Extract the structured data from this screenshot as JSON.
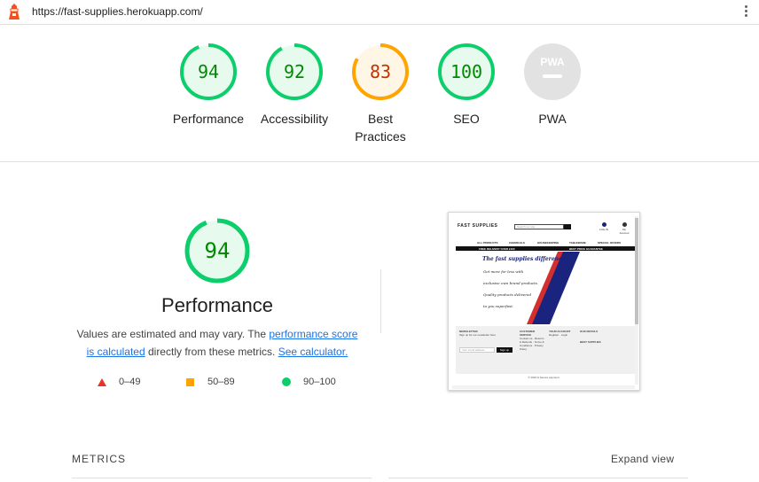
{
  "browser": {
    "url": "https://fast-supplies.herokuapp.com/"
  },
  "scores": [
    {
      "label": "Performance",
      "value": "94",
      "score": 0.94,
      "status": "pass"
    },
    {
      "label": "Accessibility",
      "value": "92",
      "score": 0.92,
      "status": "pass"
    },
    {
      "label": "Best Practices",
      "value": "83",
      "score": 0.83,
      "status": "average"
    },
    {
      "label": "SEO",
      "value": "100",
      "score": 1.0,
      "status": "pass"
    },
    {
      "label": "PWA",
      "value": "PWA",
      "score": null,
      "status": "na"
    }
  ],
  "colors": {
    "pass": "#0cce6b",
    "pass_text": "#008800",
    "pass_bg": "#e6fbee",
    "average": "#ffa400",
    "average_text": "#c33300",
    "average_bg": "#fff6e6",
    "fail": "#eb3324",
    "na": "#e2e2e2",
    "na_text": "#b9b9b9",
    "link": "#1a73e8"
  },
  "performance": {
    "score": "94",
    "title": "Performance",
    "desc_1": "Values are estimated and may vary. The ",
    "link_score_1": "performance score",
    "link_score_2": "is calculated",
    "desc_2": " directly from these metrics. ",
    "link_calc": "See calculator."
  },
  "legend": {
    "fail": "0–49",
    "average": "50–89",
    "pass": "90–100"
  },
  "screenshot": {
    "logo": "FAST SUPPLIES",
    "search_placeholder": "Search our site",
    "login": "LOG IN",
    "account": "My Account",
    "nav": [
      "ALL PRODUCTS",
      "CHEMICALS",
      "HOUSEKEEPING",
      "TABLEWARE",
      "SPECIAL OFFERS"
    ],
    "banner_left": "FREE DELIVERY OVER £100",
    "banner_right": "BEST PRICE GUARANTEE",
    "hero_title": "The fast supplies difference",
    "hero_lines": [
      "Get more for less with",
      "exclusive own brand products.",
      "Quality products delivered",
      "to you superfast."
    ],
    "newsletter": "NEWSLETTER",
    "newsletter_text": "Sign up for our newsletter here",
    "email_placeholder": "Your email address",
    "signup": "Sign up",
    "customer_service": "CUSTOMER SERVICE",
    "cs_links": "Contact us · Returns & Refunds · Terms & Conditions · Privacy Policy",
    "your_account": "YOUR ACCOUNT",
    "account_links": "Register · Login",
    "our_details": "OUR DETAILS",
    "best_supplies": "BEST SUPPLIES",
    "copyright": "© 2024 & Secure payment"
  },
  "metrics": {
    "header": "METRICS",
    "expand": "Expand view"
  }
}
